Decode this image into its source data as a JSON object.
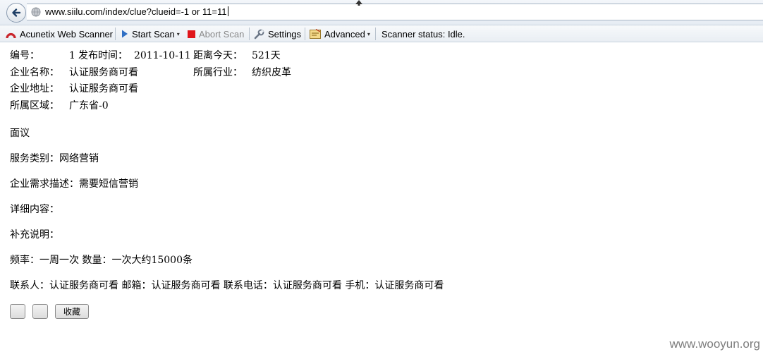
{
  "browser": {
    "url": "www.siilu.com/index/clue?clueid=-1 or 11=11"
  },
  "toolbar": {
    "brand_label": "Acunetix Web Scanner",
    "start_scan_label": "Start Scan",
    "abort_scan_label": "Abort Scan",
    "settings_label": "Settings",
    "advanced_label": "Advanced",
    "status_label": "Scanner status: Idle."
  },
  "clue": {
    "id_label": "编号：",
    "id_value": "1",
    "publish_label": "发布时间：",
    "publish_value": "2011-10-11",
    "elapsed_label": "距离今天：",
    "elapsed_value": "521天",
    "company_label": "企业名称：",
    "company_value": "认证服务商可看",
    "industry_label": "所属行业：",
    "industry_value": "纺织皮革",
    "address_label": "企业地址：",
    "address_value": "认证服务商可看",
    "region_label": "所属区域：",
    "region_value": "广东省-0"
  },
  "paragraphs": {
    "price": "面议",
    "service_type": "服务类别：网络营销",
    "demand": "企业需求描述：需要短信营销",
    "details": "详细内容：",
    "supplement": "补充说明：",
    "frequency": "频率：一周一次 数量：一次大约15000条",
    "contact": "联系人：认证服务商可看 邮箱：认证服务商可看 联系电话：认证服务商可看 手机：认证服务商可看"
  },
  "buttons": {
    "button1_label": "",
    "button2_label": "",
    "collect_label": "收藏"
  },
  "watermark": "www.wooyun.org"
}
